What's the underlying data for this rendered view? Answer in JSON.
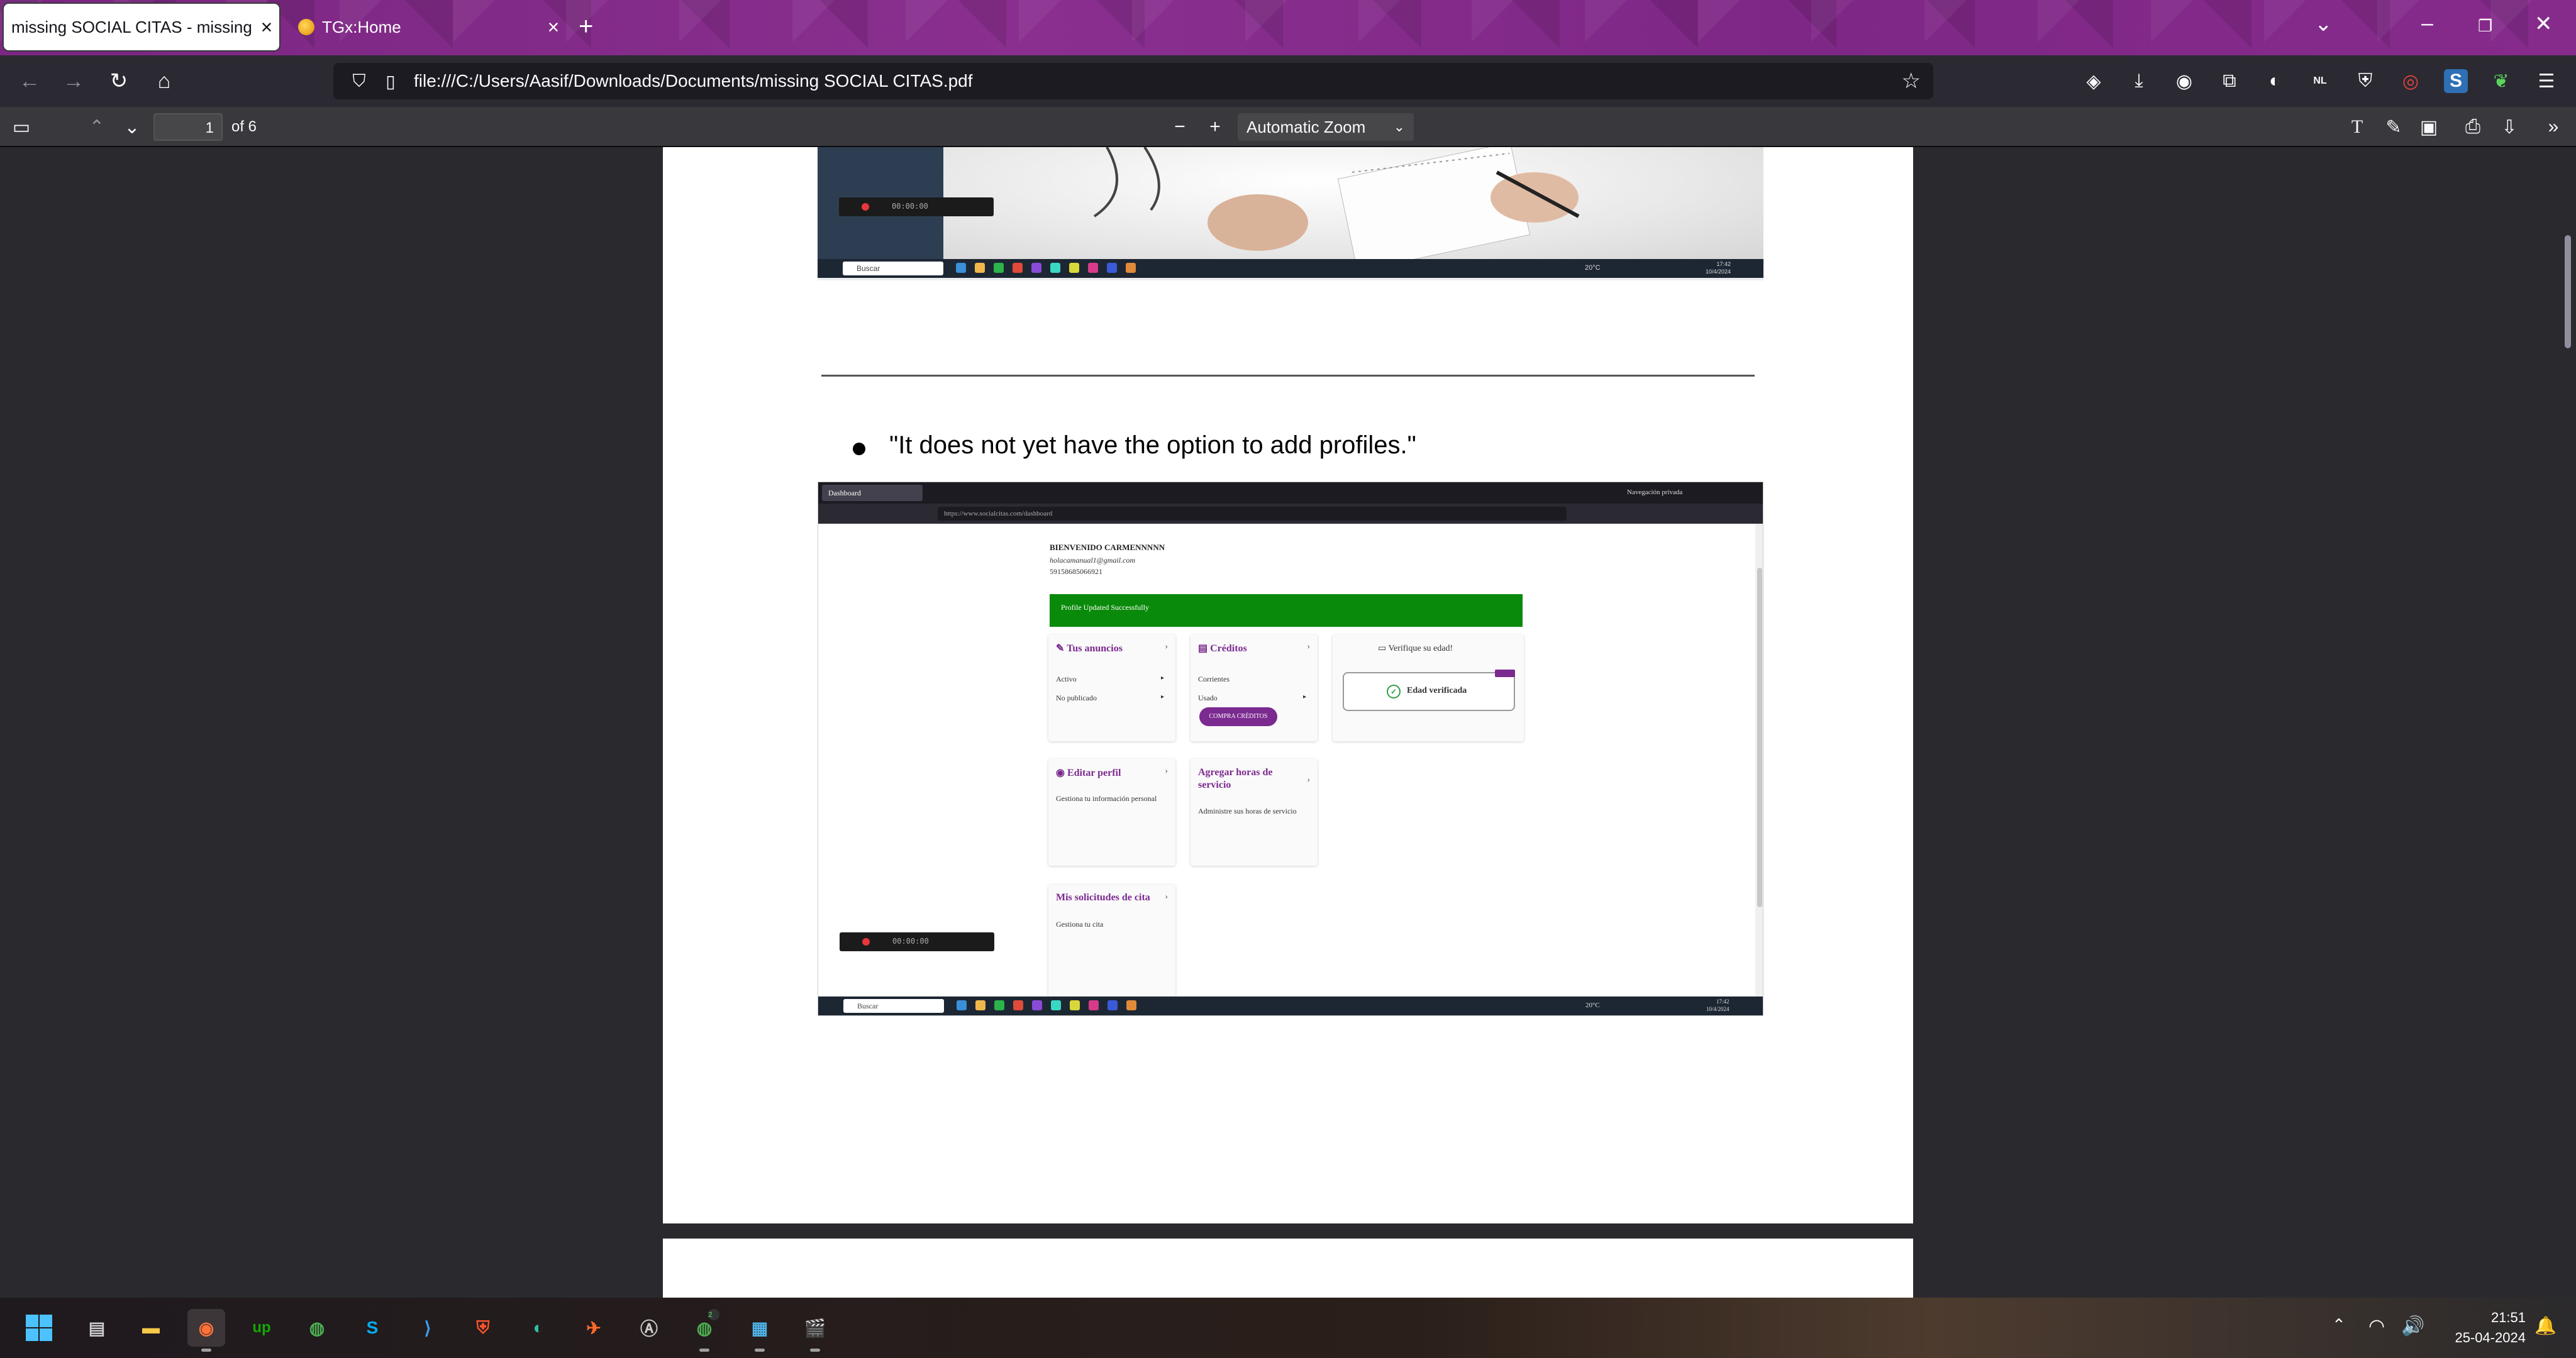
{
  "browser": {
    "tabs": [
      {
        "title": "missing SOCIAL CITAS - missing SOCIAL CITAS.pdf",
        "active": true
      },
      {
        "title": "TGx:Home",
        "active": false
      }
    ],
    "url": "file:///C:/Users/Aasif/Downloads/Documents/missing SOCIAL CITAS.pdf",
    "ext_badge": "NL"
  },
  "pdf_toolbar": {
    "page_number": "1",
    "page_count": "of 6",
    "zoom": "Automatic Zoom"
  },
  "document": {
    "bullet_text": "\"It does not yet have the option to add profiles.\""
  },
  "embedded_top": {
    "rec_time": "00:00:00",
    "search": "Buscar",
    "temp": "20°C",
    "clock_time": "17:42",
    "clock_date": "10/4/2024"
  },
  "embedded_shot": {
    "tab_title": "Dashboard",
    "private_label": "Navegación privada",
    "url": "https://www.socialcitas.com/dashboard",
    "welcome": "BIENVENIDO CARMENNNNN",
    "email": "holacamanual1@gmail.com",
    "phone": "59158685066921",
    "success": "Profile Updated Successfully",
    "card_ads": {
      "title": "Tus anuncios",
      "rows": [
        "Activo",
        "No publicado"
      ]
    },
    "card_credits": {
      "title": "Créditos",
      "rows": [
        "Corrientes",
        "Usado"
      ],
      "button": "COMPRA CRÉDITOS"
    },
    "verify_label": "Verifique su edad!",
    "age_verified": "Edad verificada",
    "card_profile": {
      "title": "Editar perfil",
      "desc": "Gestiona tu información personal"
    },
    "card_hours": {
      "title": "Agregar horas de servicio",
      "desc": "Administre sus horas de servicio"
    },
    "card_requests": {
      "title": "Mis solicitudes de cita",
      "desc": "Gestiona tu cita"
    },
    "rec_time": "00:00:00",
    "search": "Buscar",
    "temp": "20°C",
    "clock_time": "17:42",
    "clock_date": "10/4/2024"
  },
  "taskbar": {
    "time": "21:51",
    "date": "25-04-2024",
    "chrome_badge": "2"
  }
}
